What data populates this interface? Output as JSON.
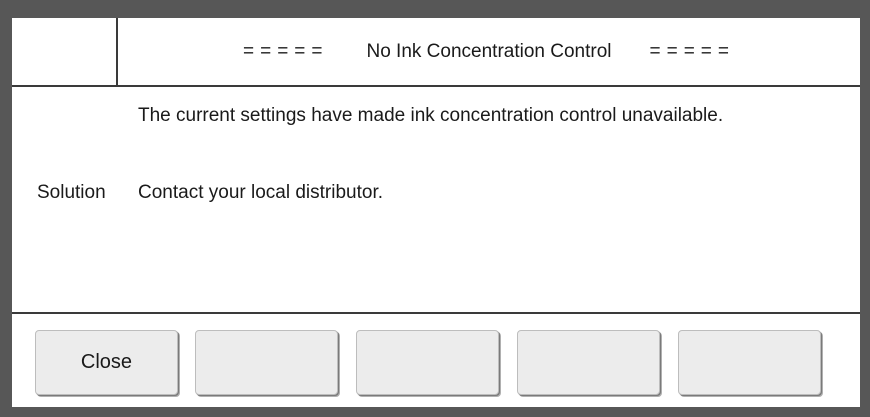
{
  "dialog": {
    "title": "No Ink Concentration Control",
    "title_deco_left": "=====",
    "title_deco_right": "=====",
    "message": "The current settings have made ink concentration control unavailable.",
    "solution_label": "Solution",
    "solution_text": "Contact your local distributor."
  },
  "buttons": {
    "close_label": "Close",
    "button2_label": "",
    "button3_label": "",
    "button4_label": "",
    "button5_label": ""
  },
  "colors": {
    "frame": "#575757",
    "panel": "#ffffff",
    "button": "#ececec",
    "text": "#1a1a1a"
  }
}
